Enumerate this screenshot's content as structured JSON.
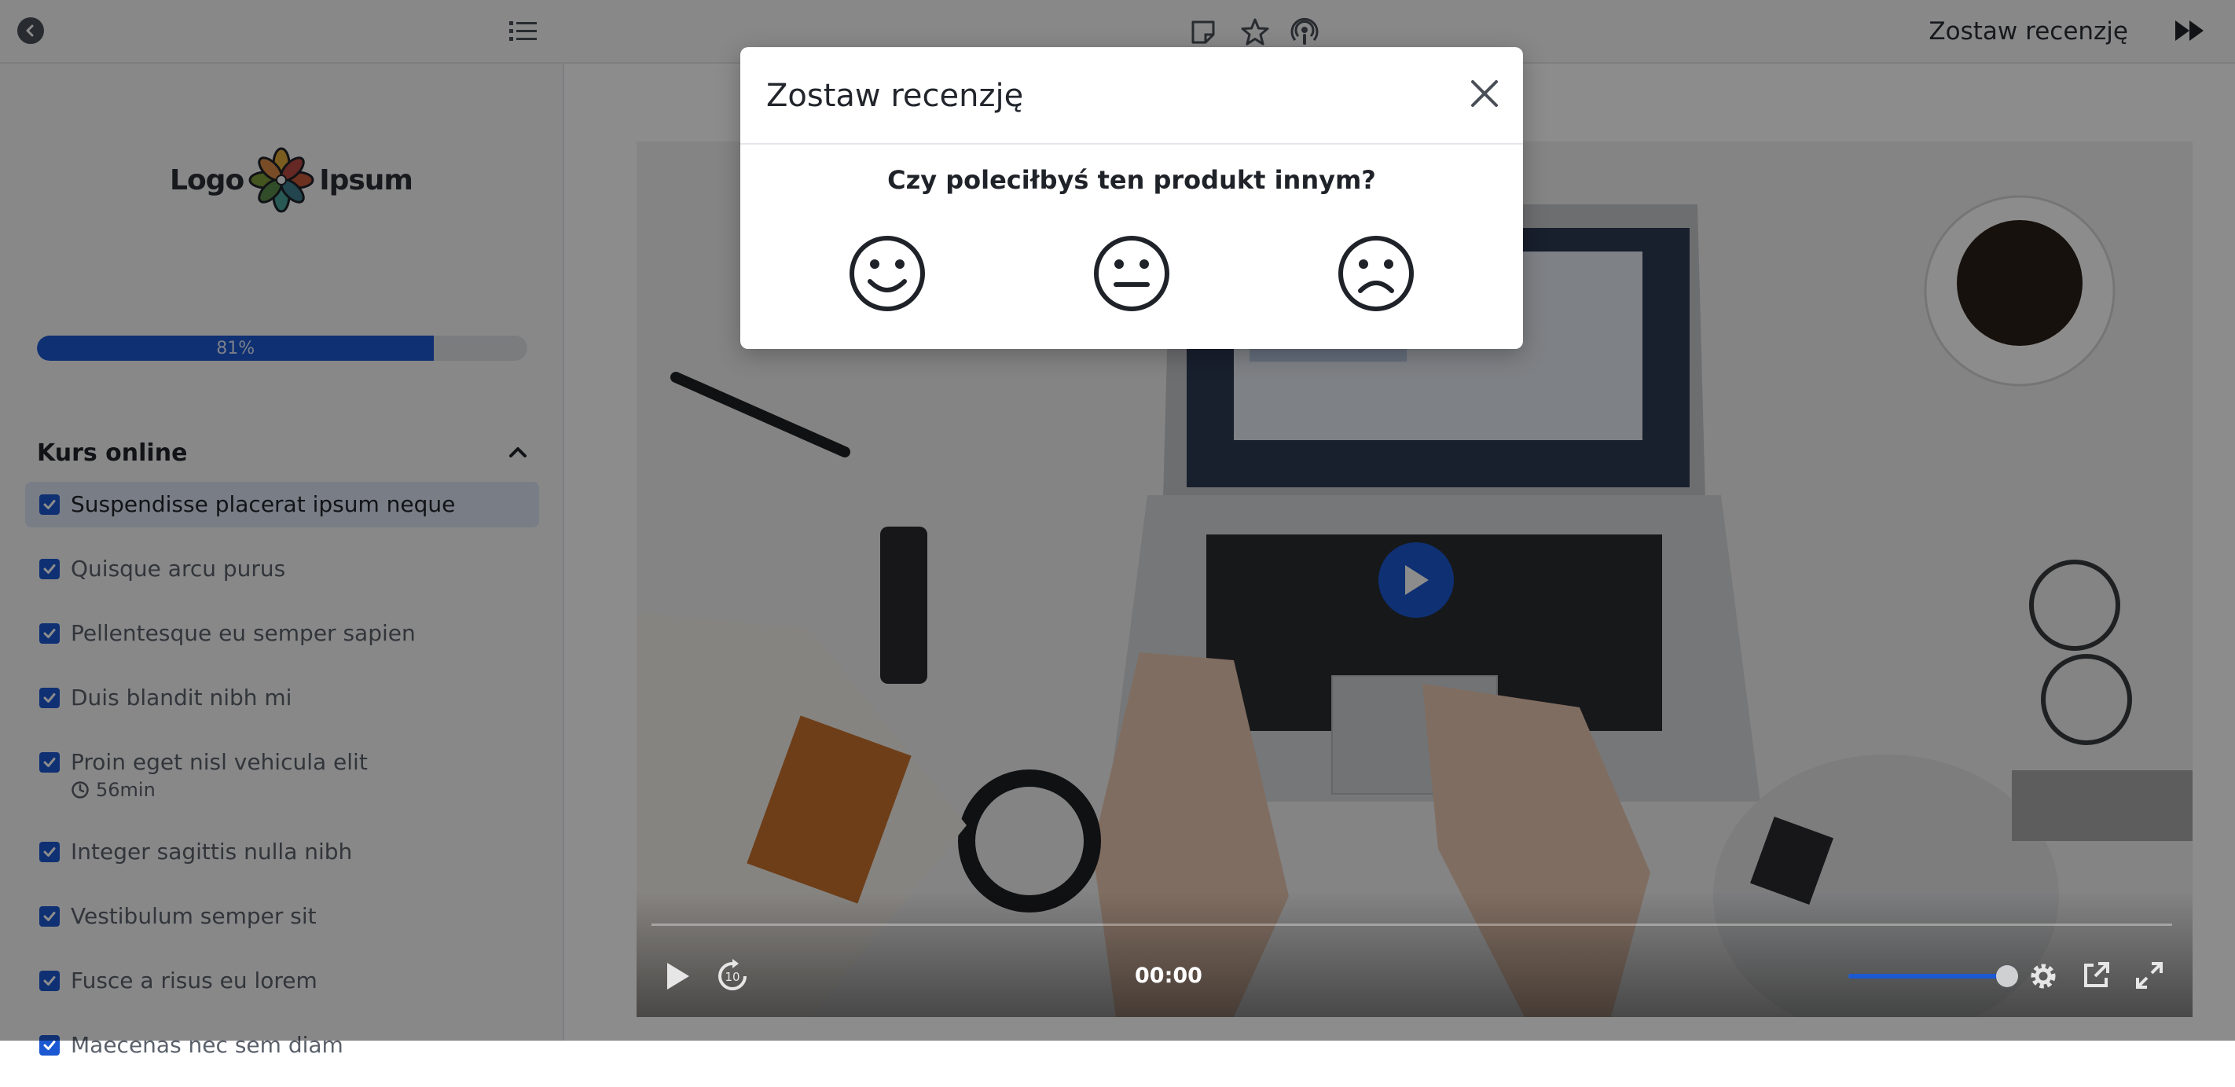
{
  "topbar": {
    "title": "Zostaw recenzję",
    "icons": [
      "back-icon",
      "list-icon",
      "note-icon",
      "star-icon",
      "podcast-icon",
      "skip-forward-icon"
    ]
  },
  "sidebar": {
    "logo_left": "Logo",
    "logo_right": "Ipsum",
    "progress": {
      "value": 0.81,
      "label": "81%"
    },
    "section_title": "Kurs online",
    "lessons": [
      {
        "label": "Suspendisse placerat ipsum neque",
        "completed": true,
        "active": true
      },
      {
        "label": "Quisque arcu purus",
        "completed": true
      },
      {
        "label": "Pellentesque eu semper sapien",
        "completed": true
      },
      {
        "label": "Duis blandit nibh mi",
        "completed": true
      },
      {
        "label": "Proin eget nisl vehicula elit",
        "completed": true,
        "duration": "56min"
      },
      {
        "label": "Integer sagittis nulla nibh",
        "completed": true
      },
      {
        "label": "Vestibulum semper sit",
        "completed": true
      },
      {
        "label": "Fusce a risus eu lorem",
        "completed": true
      },
      {
        "label": "Maecenas nec sem diam",
        "completed": true
      }
    ]
  },
  "video": {
    "time": "00:00",
    "volume": 0.95
  },
  "modal": {
    "title": "Zostaw recenzję",
    "question": "Czy poleciłbyś ten produkt innym?",
    "options": [
      "happy-face-icon",
      "neutral-face-icon",
      "sad-face-icon"
    ]
  },
  "colors": {
    "accent": "#1c58d1",
    "overlay": "rgba(0,0,0,0.45)"
  }
}
